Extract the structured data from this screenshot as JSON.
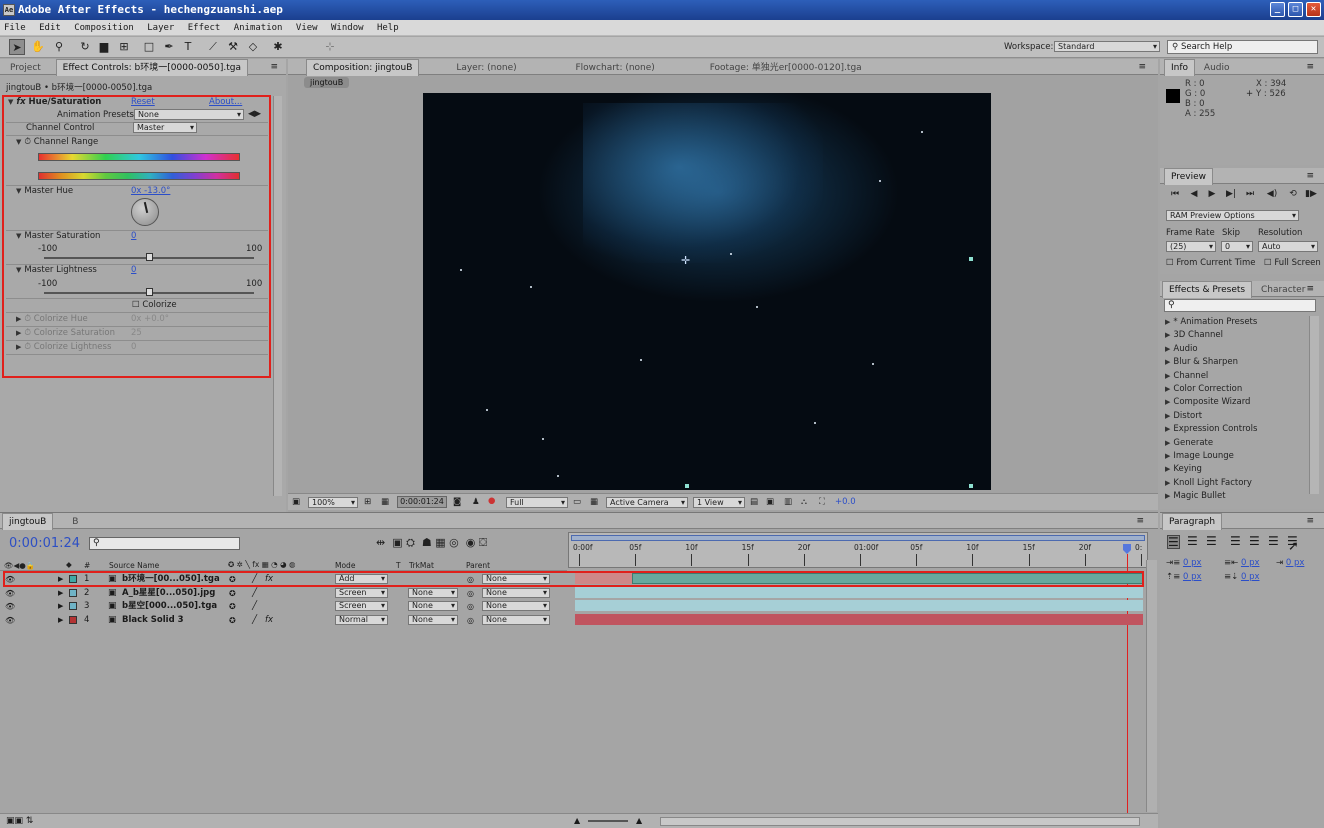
{
  "window": {
    "title": "Adobe After Effects - hechengzuanshi.aep",
    "app_icon": "Ae",
    "minimize": "_",
    "maximize": "□",
    "close": "✕"
  },
  "menu": [
    "File",
    "Edit",
    "Composition",
    "Layer",
    "Effect",
    "Animation",
    "View",
    "Window",
    "Help"
  ],
  "toolbar": {
    "workspace_label": "Workspace:",
    "workspace_value": "Standard",
    "search_help": "Search Help"
  },
  "left_panel": {
    "tab_project": "Project",
    "tab_effect_controls": "Effect Controls: b环境一[0000-0050].tga",
    "breadcrumb": "jingtouB • b环境一[0000-0050].tga",
    "effect_name": "Hue/Saturation",
    "reset": "Reset",
    "about": "About...",
    "animation_presets_label": "Animation Presets:",
    "animation_presets_value": "None",
    "channel_control_label": "Channel Control",
    "channel_control_value": "Master",
    "channel_range_label": "Channel Range",
    "master_hue_label": "Master Hue",
    "master_hue_value": "0x -13.0°",
    "master_saturation_label": "Master Saturation",
    "master_saturation_value": "0",
    "sat_min": "-100",
    "sat_max": "100",
    "master_lightness_label": "Master Lightness",
    "master_lightness_value": "0",
    "light_min": "-100",
    "light_max": "100",
    "colorize_label": "Colorize",
    "colorize_hue_label": "Colorize Hue",
    "colorize_hue_value": "0x +0.0°",
    "colorize_saturation_label": "Colorize Saturation",
    "colorize_saturation_value": "25",
    "colorize_lightness_label": "Colorize Lightness",
    "colorize_lightness_value": "0"
  },
  "comp_panel": {
    "tab_composition": "Composition: jingtouB",
    "tab_layer": "Layer: (none)",
    "tab_flowchart": "Flowchart: (none)",
    "tab_footage": "Footage: 单独光er[0000-0120].tga",
    "comp_name_chip": "jingtouB",
    "zoom": "100%",
    "timecode": "0:00:01:24",
    "resolution": "Full",
    "camera": "Active Camera",
    "views": "1 View",
    "exposure": "+0.0"
  },
  "info_panel": {
    "tab_info": "Info",
    "tab_audio": "Audio",
    "r": "R : 0",
    "g": "G : 0",
    "b": "B : 0",
    "a": "A : 255",
    "x": "X : 394",
    "y": "Y : 526"
  },
  "preview_panel": {
    "tab": "Preview",
    "ram_preview": "RAM Preview Options",
    "frame_rate_label": "Frame Rate",
    "frame_rate_value": "(25)",
    "skip_label": "Skip",
    "skip_value": "0",
    "resolution_label": "Resolution",
    "resolution_value": "Auto",
    "from_current": "From Current Time",
    "full_screen": "Full Screen"
  },
  "effects_panel": {
    "tab": "Effects & Presets",
    "tab_character": "Character",
    "items": [
      "* Animation Presets",
      "3D Channel",
      "Audio",
      "Blur & Sharpen",
      "Channel",
      "Color Correction",
      "Composite Wizard",
      "Distort",
      "Expression Controls",
      "Generate",
      "Image Lounge",
      "Keying",
      "Knoll Light Factory",
      "Magic Bullet"
    ]
  },
  "paragraph_panel": {
    "tab": "Paragraph",
    "indent_left": "0 px",
    "indent_right": "0 px",
    "indent_first": "0 px",
    "space_before": "0 px",
    "space_after": "0 px"
  },
  "timeline": {
    "tab": "jingtouB",
    "tab2": "B",
    "timecode": "0:00:01:24",
    "columns": {
      "num": "#",
      "source_name": "Source Name",
      "mode": "Mode",
      "t": "T",
      "trkmat": "TrkMat",
      "parent": "Parent"
    },
    "ruler": [
      "0:00f",
      "05f",
      "10f",
      "15f",
      "20f",
      "01:00f",
      "05f",
      "10f",
      "15f",
      "20f",
      "0:"
    ],
    "layers": [
      {
        "num": "1",
        "name": "b环境一[00...050].tga",
        "mode": "Add",
        "trkmat": "",
        "parent": "None",
        "color": "#3fa9a5"
      },
      {
        "num": "2",
        "name": "A_b星星[0...050].jpg",
        "mode": "Screen",
        "trkmat": "None",
        "parent": "None",
        "color": "#6fb3c6"
      },
      {
        "num": "3",
        "name": "b星空[000...050].tga",
        "mode": "Screen",
        "trkmat": "None",
        "parent": "None",
        "color": "#6fb3c6"
      },
      {
        "num": "4",
        "name": "Black Solid 3",
        "mode": "Normal",
        "trkmat": "None",
        "parent": "None",
        "color": "#b33333"
      }
    ]
  }
}
